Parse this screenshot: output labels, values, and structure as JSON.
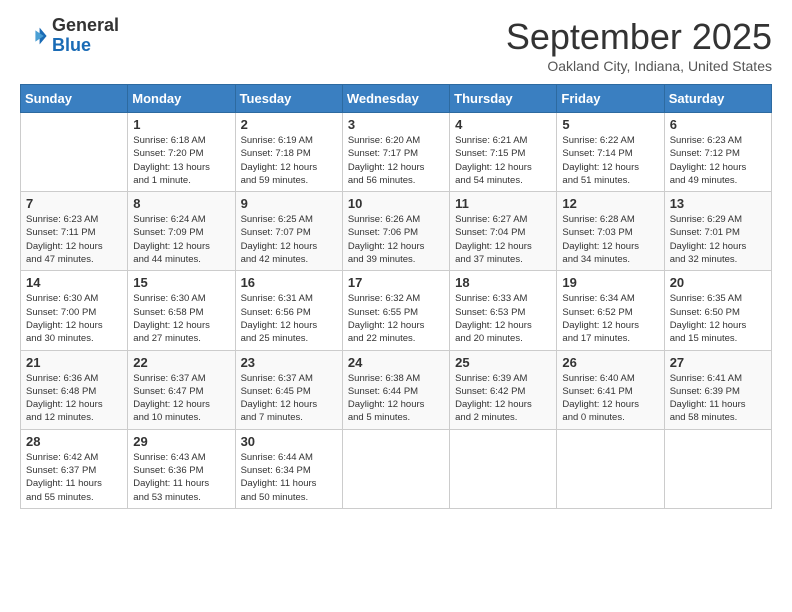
{
  "header": {
    "logo_line1": "General",
    "logo_line2": "Blue",
    "month": "September 2025",
    "location": "Oakland City, Indiana, United States"
  },
  "days_of_week": [
    "Sunday",
    "Monday",
    "Tuesday",
    "Wednesday",
    "Thursday",
    "Friday",
    "Saturday"
  ],
  "weeks": [
    [
      {
        "day": "",
        "info": ""
      },
      {
        "day": "1",
        "info": "Sunrise: 6:18 AM\nSunset: 7:20 PM\nDaylight: 13 hours\nand 1 minute."
      },
      {
        "day": "2",
        "info": "Sunrise: 6:19 AM\nSunset: 7:18 PM\nDaylight: 12 hours\nand 59 minutes."
      },
      {
        "day": "3",
        "info": "Sunrise: 6:20 AM\nSunset: 7:17 PM\nDaylight: 12 hours\nand 56 minutes."
      },
      {
        "day": "4",
        "info": "Sunrise: 6:21 AM\nSunset: 7:15 PM\nDaylight: 12 hours\nand 54 minutes."
      },
      {
        "day": "5",
        "info": "Sunrise: 6:22 AM\nSunset: 7:14 PM\nDaylight: 12 hours\nand 51 minutes."
      },
      {
        "day": "6",
        "info": "Sunrise: 6:23 AM\nSunset: 7:12 PM\nDaylight: 12 hours\nand 49 minutes."
      }
    ],
    [
      {
        "day": "7",
        "info": "Sunrise: 6:23 AM\nSunset: 7:11 PM\nDaylight: 12 hours\nand 47 minutes."
      },
      {
        "day": "8",
        "info": "Sunrise: 6:24 AM\nSunset: 7:09 PM\nDaylight: 12 hours\nand 44 minutes."
      },
      {
        "day": "9",
        "info": "Sunrise: 6:25 AM\nSunset: 7:07 PM\nDaylight: 12 hours\nand 42 minutes."
      },
      {
        "day": "10",
        "info": "Sunrise: 6:26 AM\nSunset: 7:06 PM\nDaylight: 12 hours\nand 39 minutes."
      },
      {
        "day": "11",
        "info": "Sunrise: 6:27 AM\nSunset: 7:04 PM\nDaylight: 12 hours\nand 37 minutes."
      },
      {
        "day": "12",
        "info": "Sunrise: 6:28 AM\nSunset: 7:03 PM\nDaylight: 12 hours\nand 34 minutes."
      },
      {
        "day": "13",
        "info": "Sunrise: 6:29 AM\nSunset: 7:01 PM\nDaylight: 12 hours\nand 32 minutes."
      }
    ],
    [
      {
        "day": "14",
        "info": "Sunrise: 6:30 AM\nSunset: 7:00 PM\nDaylight: 12 hours\nand 30 minutes."
      },
      {
        "day": "15",
        "info": "Sunrise: 6:30 AM\nSunset: 6:58 PM\nDaylight: 12 hours\nand 27 minutes."
      },
      {
        "day": "16",
        "info": "Sunrise: 6:31 AM\nSunset: 6:56 PM\nDaylight: 12 hours\nand 25 minutes."
      },
      {
        "day": "17",
        "info": "Sunrise: 6:32 AM\nSunset: 6:55 PM\nDaylight: 12 hours\nand 22 minutes."
      },
      {
        "day": "18",
        "info": "Sunrise: 6:33 AM\nSunset: 6:53 PM\nDaylight: 12 hours\nand 20 minutes."
      },
      {
        "day": "19",
        "info": "Sunrise: 6:34 AM\nSunset: 6:52 PM\nDaylight: 12 hours\nand 17 minutes."
      },
      {
        "day": "20",
        "info": "Sunrise: 6:35 AM\nSunset: 6:50 PM\nDaylight: 12 hours\nand 15 minutes."
      }
    ],
    [
      {
        "day": "21",
        "info": "Sunrise: 6:36 AM\nSunset: 6:48 PM\nDaylight: 12 hours\nand 12 minutes."
      },
      {
        "day": "22",
        "info": "Sunrise: 6:37 AM\nSunset: 6:47 PM\nDaylight: 12 hours\nand 10 minutes."
      },
      {
        "day": "23",
        "info": "Sunrise: 6:37 AM\nSunset: 6:45 PM\nDaylight: 12 hours\nand 7 minutes."
      },
      {
        "day": "24",
        "info": "Sunrise: 6:38 AM\nSunset: 6:44 PM\nDaylight: 12 hours\nand 5 minutes."
      },
      {
        "day": "25",
        "info": "Sunrise: 6:39 AM\nSunset: 6:42 PM\nDaylight: 12 hours\nand 2 minutes."
      },
      {
        "day": "26",
        "info": "Sunrise: 6:40 AM\nSunset: 6:41 PM\nDaylight: 12 hours\nand 0 minutes."
      },
      {
        "day": "27",
        "info": "Sunrise: 6:41 AM\nSunset: 6:39 PM\nDaylight: 11 hours\nand 58 minutes."
      }
    ],
    [
      {
        "day": "28",
        "info": "Sunrise: 6:42 AM\nSunset: 6:37 PM\nDaylight: 11 hours\nand 55 minutes."
      },
      {
        "day": "29",
        "info": "Sunrise: 6:43 AM\nSunset: 6:36 PM\nDaylight: 11 hours\nand 53 minutes."
      },
      {
        "day": "30",
        "info": "Sunrise: 6:44 AM\nSunset: 6:34 PM\nDaylight: 11 hours\nand 50 minutes."
      },
      {
        "day": "",
        "info": ""
      },
      {
        "day": "",
        "info": ""
      },
      {
        "day": "",
        "info": ""
      },
      {
        "day": "",
        "info": ""
      }
    ]
  ]
}
